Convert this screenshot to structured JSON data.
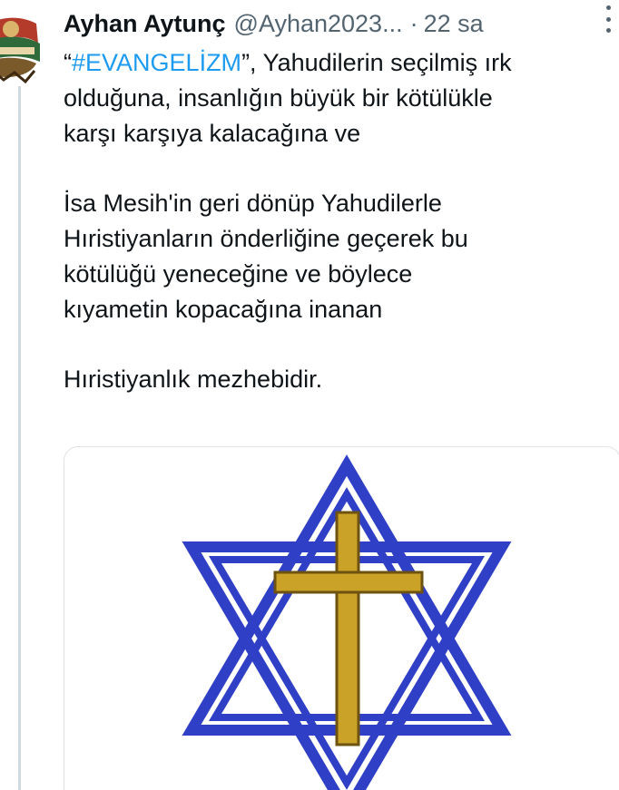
{
  "tweet": {
    "author_name": "Ayhan Aytunç",
    "handle": "@Ayhan2023...",
    "separator": "·",
    "time": "22 sa",
    "hashtag": "#EVANGELİZM",
    "quote_open": "“",
    "line1_rest": "”, Yahudilerin seçilmiş ırk",
    "line2": "olduğuna, insanlığın büyük bir kötülükle",
    "line3": "karşı karşıya kalacağına ve",
    "para2_line1": "İsa Mesih'in geri dönüp Yahudilerle",
    "para2_line2": "Hıristiyanların önderliğine geçerek bu",
    "para2_line3": "kötülüğü yeneceğine ve böylece",
    "para2_line4": "kıyametin kopacağına inanan",
    "para3_line1": "Hıristiyanlık mezhebidir."
  },
  "icons": {
    "avatar": "avatar-logo",
    "more": "more-options-icon"
  },
  "colors": {
    "text": "#0f1419",
    "secondary": "#536471",
    "hashtag": "#1d9bf0",
    "star_blue": "#2f3fc6",
    "cross_gold": "#c9a227"
  },
  "media": {
    "image": "star-of-david-with-cross"
  }
}
